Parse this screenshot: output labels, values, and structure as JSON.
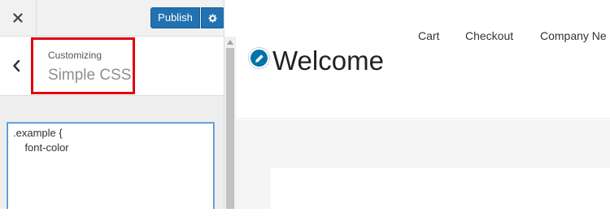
{
  "topbar": {
    "close_icon": "close-icon",
    "publish_label": "Publish",
    "settings_icon": "gear-icon"
  },
  "section": {
    "back_icon": "chevron-left-icon",
    "customizing_label": "Customizing",
    "title": "Simple CSS"
  },
  "css_editor": {
    "lines": [
      ".example {",
      "    font-color"
    ]
  },
  "preview": {
    "nav": [
      "Cart",
      "Checkout",
      "Company Ne"
    ],
    "edit_icon": "pencil-icon",
    "site_title": "Welcome"
  },
  "colors": {
    "accent": "#2271b1",
    "highlight_border": "#e3000f",
    "edit_shortcut": "#0073aa"
  }
}
